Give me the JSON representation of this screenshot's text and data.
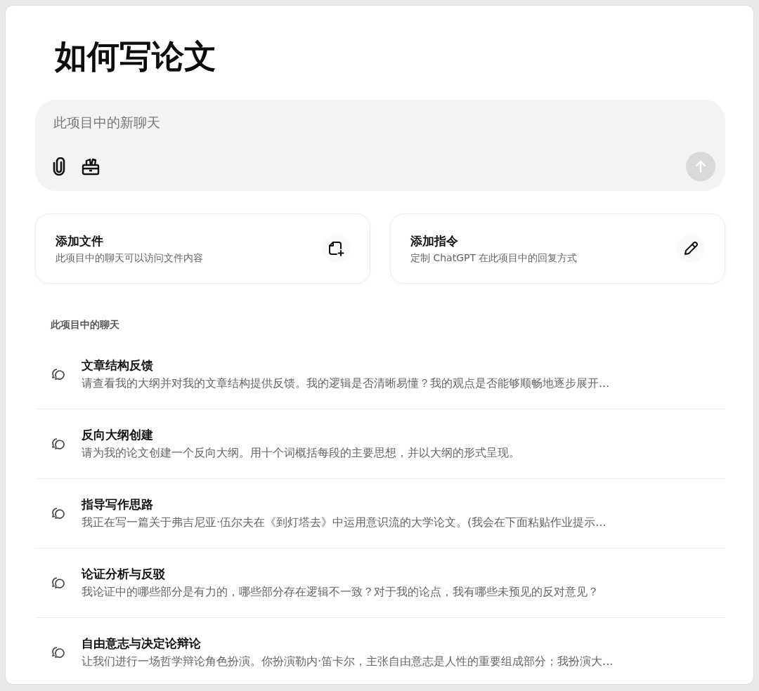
{
  "title": "如何写论文",
  "composer": {
    "placeholder": "此项目中的新聊天"
  },
  "cards": [
    {
      "kind": "files",
      "title": "添加文件",
      "subtitle": "此项目中的聊天可以访问文件内容"
    },
    {
      "kind": "instructions",
      "title": "添加指令",
      "subtitle": "定制 ChatGPT 在此项目中的回复方式"
    }
  ],
  "section_label": "此项目中的聊天",
  "chats": [
    {
      "title": "文章结构反馈",
      "preview": "请查看我的大纲并对我的文章结构提供反馈。我的逻辑是否清晰易懂？我的观点是否能够顺畅地逐步展开..."
    },
    {
      "title": "反向大纲创建",
      "preview": "请为我的论文创建一个反向大纲。用十个词概括每段的主要思想，并以大纲的形式呈现。"
    },
    {
      "title": "指导写作思路",
      "preview": "我正在写一篇关于弗吉尼亚·伍尔夫在《到灯塔去》中运用意识流的大学论文。(我会在下面粘贴作业提示..."
    },
    {
      "title": "论证分析与反驳",
      "preview": "我论证中的哪些部分是有力的，哪些部分存在逻辑不一致？对于我的论点，我有哪些未预见的反对意见？"
    },
    {
      "title": "自由意志与决定论辩论",
      "preview": "让我们进行一场哲学辩论角色扮演。你扮演勒内·笛卡尔，主张自由意志是人性的重要组成部分；我扮演大..."
    }
  ]
}
